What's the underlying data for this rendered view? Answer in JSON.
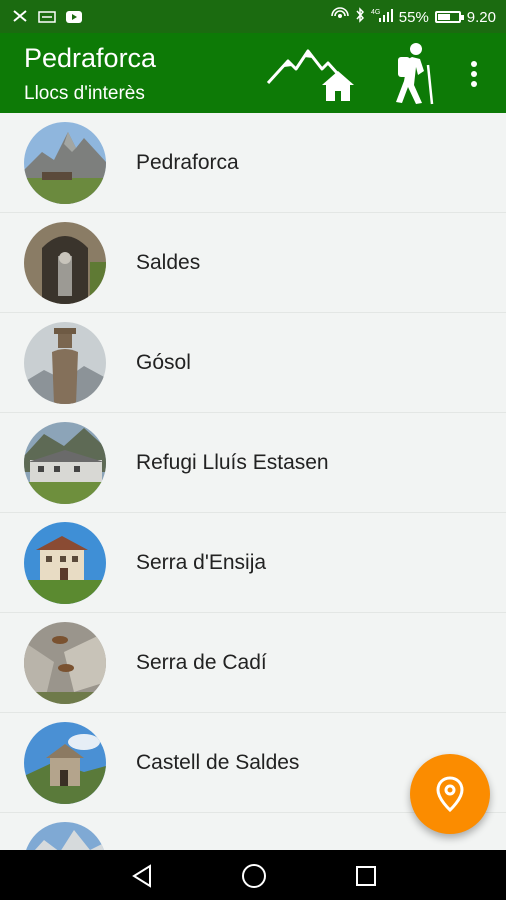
{
  "status_bar": {
    "battery_percent": "55%",
    "time": "9.20",
    "battery_level": 0.55,
    "network": "4G"
  },
  "app_bar": {
    "title": "Pedraforca",
    "subtitle": "Llocs d'interès",
    "actions": [
      "mountain-refuge-icon",
      "hiker-icon",
      "more-vert-icon"
    ]
  },
  "places": [
    {
      "name": "Pedraforca",
      "thumb": "mountain-peak-photo"
    },
    {
      "name": "Saldes",
      "thumb": "stone-shrine-photo"
    },
    {
      "name": "Gósol",
      "thumb": "statue-photo"
    },
    {
      "name": "Refugi Lluís Estasen",
      "thumb": "refuge-building-photo"
    },
    {
      "name": "Serra d'Ensija",
      "thumb": "mountain-house-photo"
    },
    {
      "name": "Serra de Cadí",
      "thumb": "chamois-rocks-photo"
    },
    {
      "name": "Castell de Saldes",
      "thumb": "hermitage-photo"
    },
    {
      "name": "",
      "thumb": "snowy-peak-photo"
    }
  ],
  "fab": {
    "icon": "location-pin-icon",
    "color": "#fb8c00"
  },
  "colors": {
    "status_bar": "#1b6b10",
    "app_bar": "#0d7a06",
    "list_bg": "#f2f4f3"
  },
  "nav_bar": [
    "back-icon",
    "home-icon",
    "recents-icon"
  ]
}
